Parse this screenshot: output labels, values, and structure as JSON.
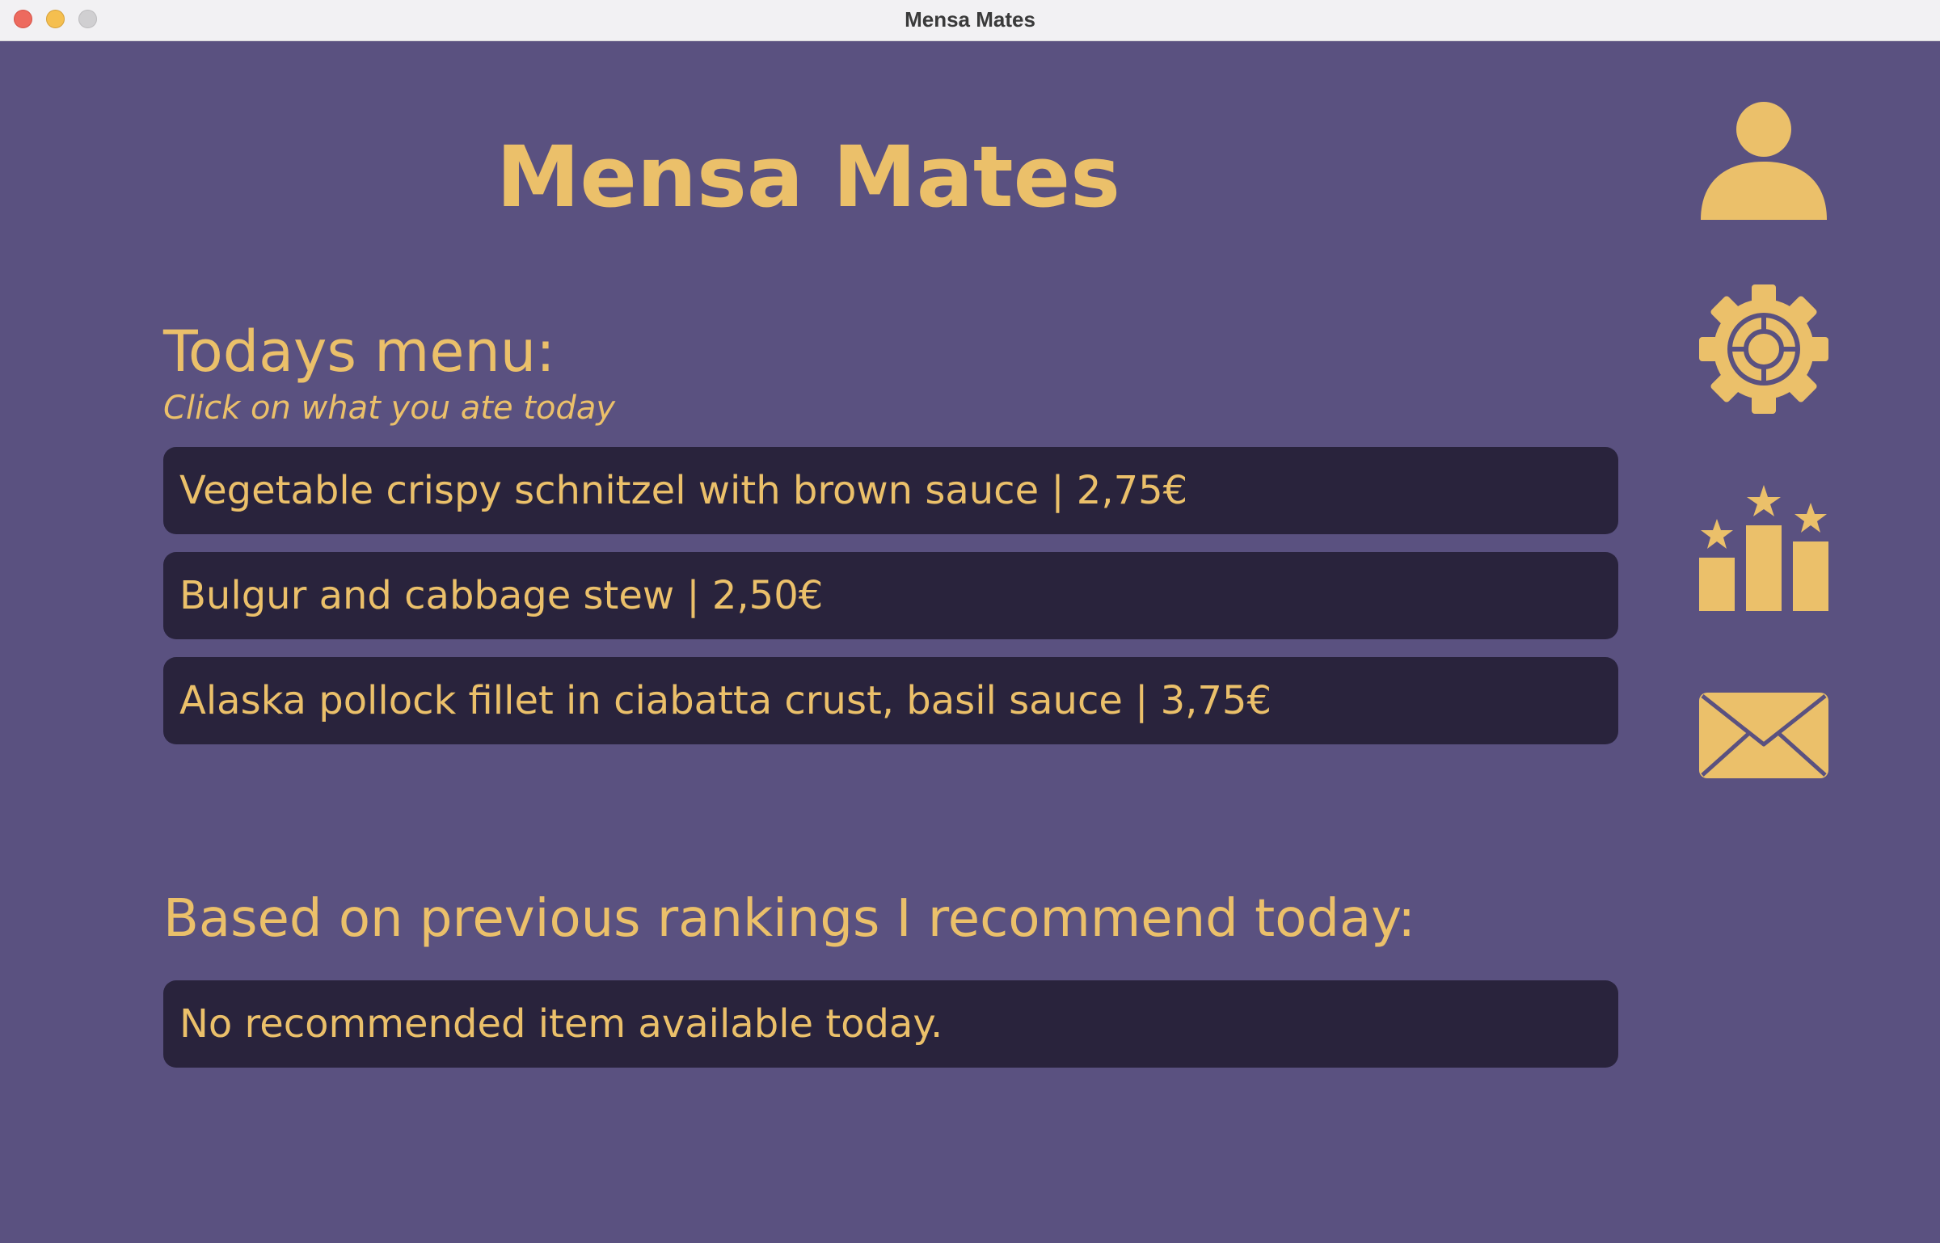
{
  "window": {
    "title": "Mensa Mates"
  },
  "app": {
    "title": "Mensa Mates"
  },
  "menu": {
    "heading": "Todays menu:",
    "subtitle": "Click on what you ate today",
    "items": [
      {
        "label": "Vegetable crispy schnitzel with brown sauce | 2,75€"
      },
      {
        "label": "Bulgur and cabbage stew | 2,50€"
      },
      {
        "label": "Alaska pollock fillet in ciabatta crust, basil sauce | 3,75€"
      }
    ]
  },
  "recommendation": {
    "heading": "Based on previous rankings I recommend today:",
    "text": "No recommended item available today."
  },
  "sidebar": {
    "icons": [
      "person-icon",
      "gear-icon",
      "ranking-podium-icon",
      "mail-icon"
    ]
  },
  "colors": {
    "background": "#5a5180",
    "accent": "#ebc06a",
    "item_background": "#29233c"
  }
}
